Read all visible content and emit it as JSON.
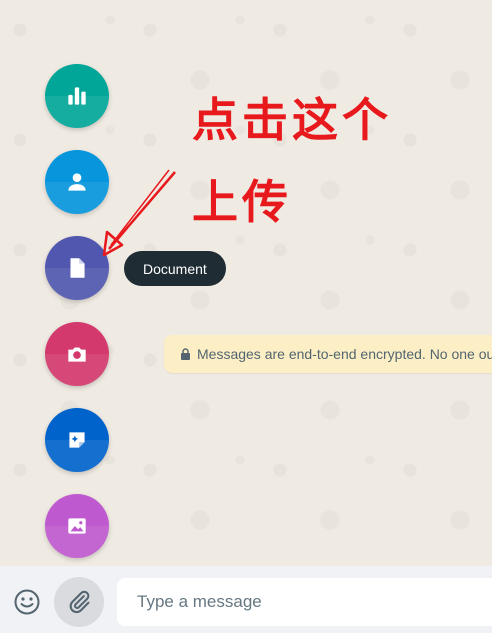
{
  "attach_menu": {
    "items": [
      {
        "name": "poll",
        "icon": "bar-chart-icon",
        "color": "#02a698"
      },
      {
        "name": "contact",
        "icon": "person-icon",
        "color": "#0795dc"
      },
      {
        "name": "document",
        "icon": "document-icon",
        "color": "#5157ae"
      },
      {
        "name": "camera",
        "icon": "camera-icon",
        "color": "#d3396d"
      },
      {
        "name": "sticker",
        "icon": "sticker-icon",
        "color": "#0063cb"
      },
      {
        "name": "photos-videos",
        "icon": "image-icon",
        "color": "#bf59cf"
      }
    ]
  },
  "tooltip": {
    "text": "Document"
  },
  "encryption_banner": {
    "text": "Messages are end-to-end encrypted. No one outside of this chat, not even WhatsApp, can read or listen to them."
  },
  "annotation": {
    "line1": "点击这个",
    "line2": "上传",
    "color": "#e8191c"
  },
  "composer": {
    "placeholder": "Type a message"
  }
}
